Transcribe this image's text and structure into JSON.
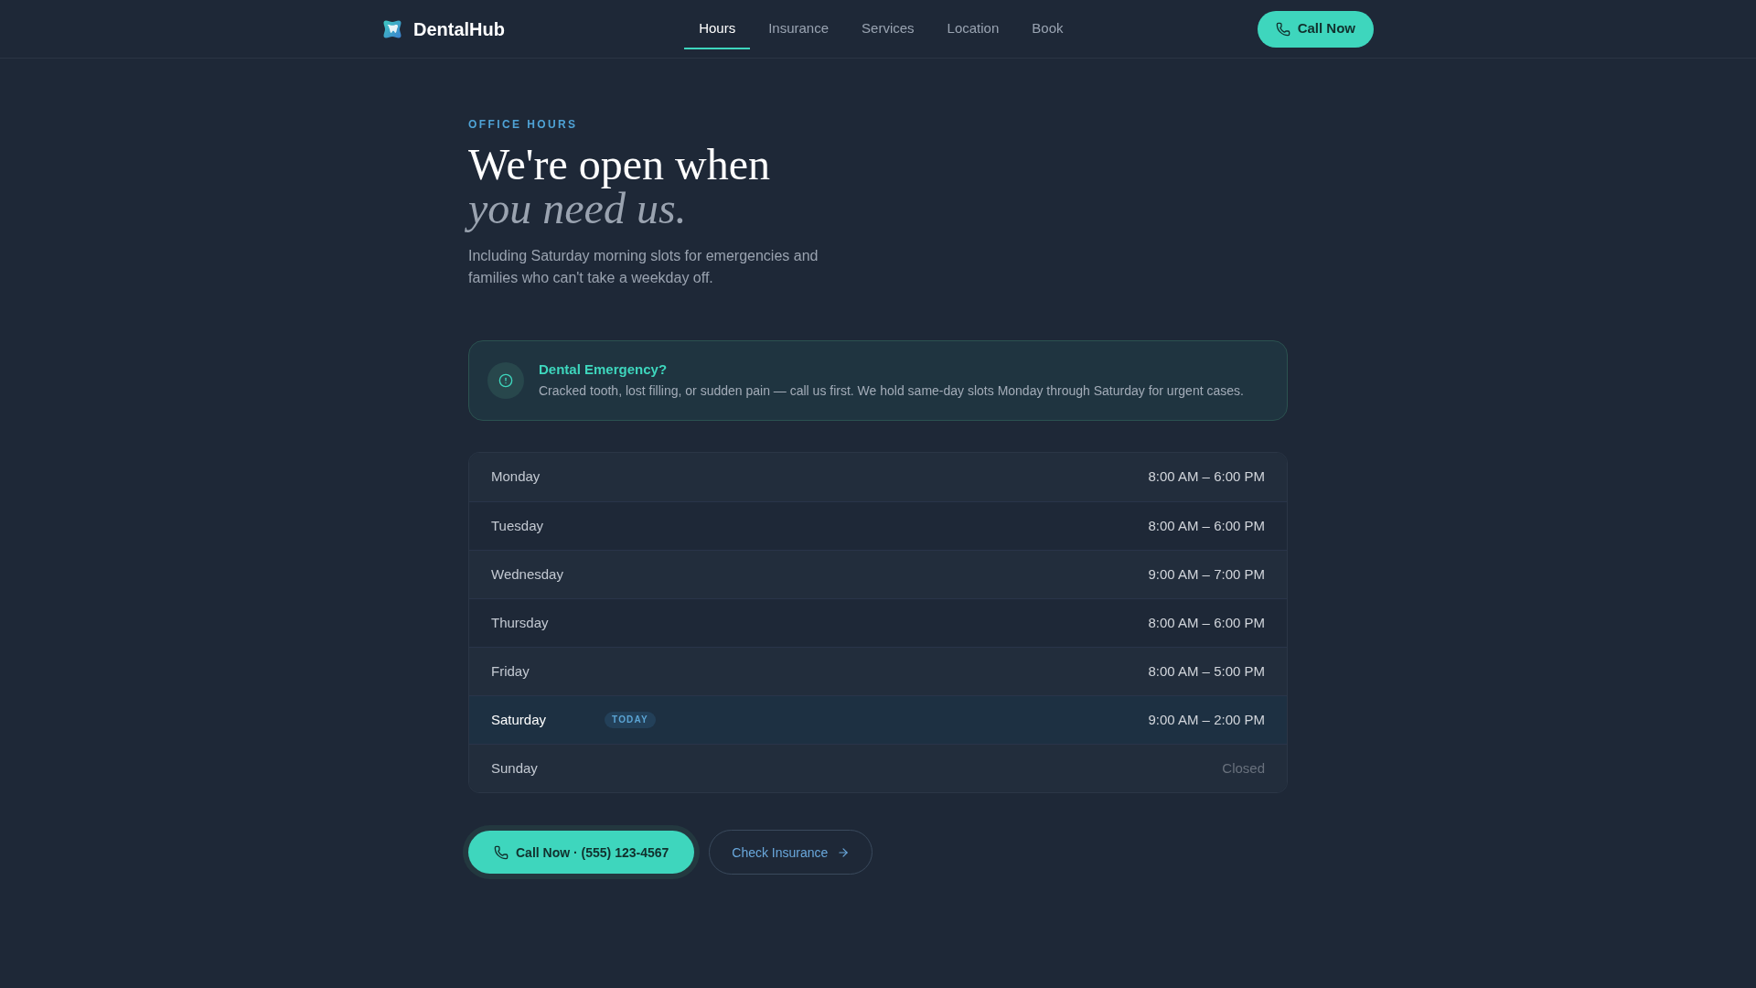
{
  "nav": {
    "brand": "DentalHub",
    "links": [
      {
        "label": "Hours",
        "selected": true
      },
      {
        "label": "Insurance",
        "selected": false
      },
      {
        "label": "Services",
        "selected": false
      },
      {
        "label": "Location",
        "selected": false
      },
      {
        "label": "Book",
        "selected": false
      }
    ],
    "cta": "Call Now"
  },
  "hero": {
    "eyebrow": "OFFICE HOURS",
    "title": "We're open when *you need us.*",
    "subtitle": "Including Saturday morning slots for emergencies and families who can't take a weekday off."
  },
  "alert": {
    "title": "Dental Emergency?",
    "body": "Cracked tooth, lost filling, or sudden pain — call us first. We hold same-day slots Monday through Saturday for urgent cases."
  },
  "hours": [
    {
      "day": "Monday",
      "hours": "8:00 AM – 6:00 PM",
      "today": false,
      "closed": false
    },
    {
      "day": "Tuesday",
      "hours": "8:00 AM – 6:00 PM",
      "today": false,
      "closed": false
    },
    {
      "day": "Wednesday",
      "hours": "9:00 AM – 7:00 PM",
      "today": false,
      "closed": false
    },
    {
      "day": "Thursday",
      "hours": "8:00 AM – 6:00 PM",
      "today": false,
      "closed": false
    },
    {
      "day": "Friday",
      "hours": "8:00 AM – 5:00 PM",
      "today": false,
      "closed": false
    },
    {
      "day": "Saturday",
      "hours": "9:00 AM – 2:00 PM",
      "today": true,
      "badge": "TODAY",
      "closed": false
    },
    {
      "day": "Sunday",
      "hours": "Closed",
      "today": false,
      "closed": true
    }
  ],
  "actions": [
    {
      "kind": "primary",
      "label": "Call Now · (555) 123-4567"
    },
    {
      "kind": "secondary",
      "label": "Check Insurance"
    }
  ]
}
